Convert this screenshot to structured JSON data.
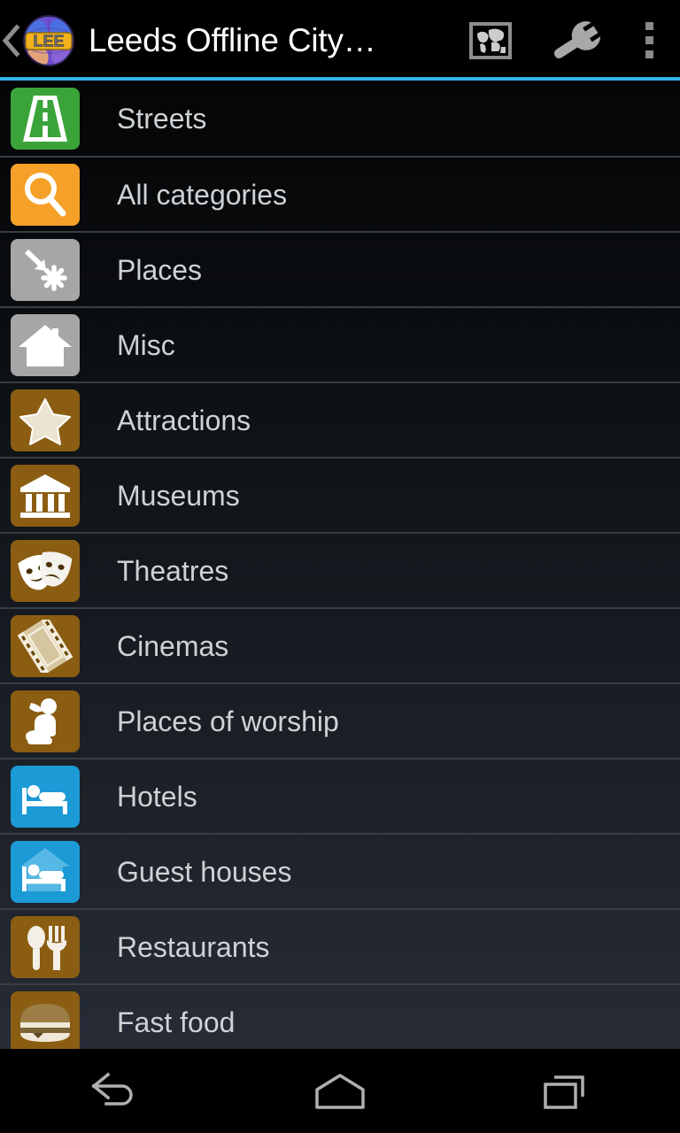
{
  "action_bar": {
    "up_icon": "back-chevron-icon",
    "app_logo_icon": "app-logo-globe-lee-icon",
    "app_logo_text": "LEE",
    "title": "Leeds Offline City…",
    "actions": [
      {
        "name": "map-image-icon",
        "label": "World map"
      },
      {
        "name": "wrench-icon",
        "label": "Tools"
      },
      {
        "name": "overflow-menu-icon",
        "label": "More options"
      }
    ],
    "accent_color": "#33b5e5",
    "background_color": "#000000",
    "title_color": "#ffffff"
  },
  "list": {
    "divider_color": "#3a3d42",
    "label_color": "#cfd2d4",
    "items": [
      {
        "label": "Streets",
        "icon": "road-icon",
        "tile_color": "#3aa43a",
        "glyph_color": "#ffffff"
      },
      {
        "label": "All categories",
        "icon": "magnifier-icon",
        "tile_color": "#f5a028",
        "glyph_color": "#ffffff"
      },
      {
        "label": "Places",
        "icon": "arrow-asterisk-icon",
        "tile_color": "#a6a6a6",
        "glyph_color": "#ffffff"
      },
      {
        "label": "Misc",
        "icon": "house-icon",
        "tile_color": "#a6a6a6",
        "glyph_color": "#ffffff"
      },
      {
        "label": "Attractions",
        "icon": "star-icon",
        "tile_color": "#8a5d12",
        "glyph_color": "#ece4d2"
      },
      {
        "label": "Museums",
        "icon": "museum-icon",
        "tile_color": "#8a5d12",
        "glyph_color": "#ffffff"
      },
      {
        "label": "Theatres",
        "icon": "theatre-masks-icon",
        "tile_color": "#8a5d12",
        "glyph_color": "#ffffff"
      },
      {
        "label": "Cinemas",
        "icon": "film-strip-icon",
        "tile_color": "#8a5d12",
        "glyph_color": "#d6c6a0"
      },
      {
        "label": "Places of worship",
        "icon": "praying-person-icon",
        "tile_color": "#8a5d12",
        "glyph_color": "#ffffff"
      },
      {
        "label": "Hotels",
        "icon": "bed-icon",
        "tile_color": "#1b9ad6",
        "glyph_color": "#ffffff"
      },
      {
        "label": "Guest houses",
        "icon": "bed-under-roof-icon",
        "tile_color": "#1b9ad6",
        "glyph_color": "#ffffff"
      },
      {
        "label": "Restaurants",
        "icon": "spoon-fork-icon",
        "tile_color": "#8a5d12",
        "glyph_color": "#f3efe6"
      },
      {
        "label": "Fast food",
        "icon": "burger-icon",
        "tile_color": "#8a5d12",
        "glyph_color": "#9b7d45"
      }
    ]
  },
  "nav_bar": {
    "buttons": [
      {
        "name": "nav-back-button",
        "label": "Back"
      },
      {
        "name": "nav-home-button",
        "label": "Home"
      },
      {
        "name": "nav-recents-button",
        "label": "Recents"
      }
    ],
    "icon_color": "#b0b0b0",
    "background_color": "#000000"
  }
}
